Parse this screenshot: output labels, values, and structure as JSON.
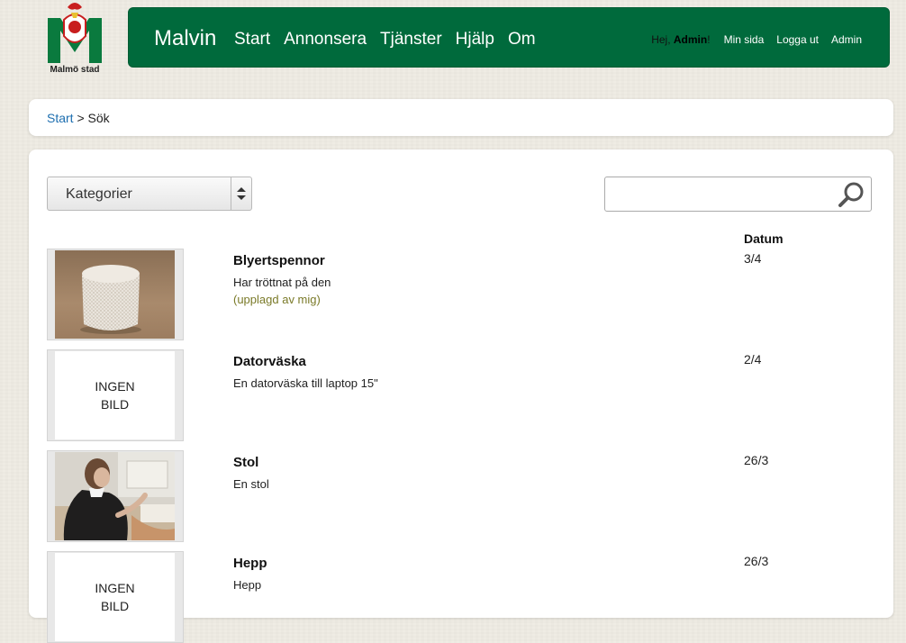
{
  "logo": {
    "text": "Malmö stad"
  },
  "header": {
    "brand": "Malvin",
    "nav": [
      "Start",
      "Annonsera",
      "Tjänster",
      "Hjälp",
      "Om"
    ],
    "greeting_prefix": "Hej, ",
    "user": "Admin",
    "greeting_suffix": "!",
    "links": [
      "Min sida",
      "Logga ut",
      "Admin"
    ]
  },
  "breadcrumb": {
    "home": "Start",
    "separator": " > ",
    "current": "Sök"
  },
  "filters": {
    "category_label": "Kategorier",
    "search_value": ""
  },
  "list": {
    "date_header": "Datum",
    "items": [
      {
        "title": "Blyertspennor",
        "description": "Har tröttnat på den",
        "owner_note": "(upplagd av mig)",
        "date": "3/4",
        "image": "coconut-cake-photo",
        "no_image_text": ""
      },
      {
        "title": "Datorväska",
        "description": "En datorväska till laptop 15\"",
        "owner_note": "",
        "date": "2/4",
        "image": "none",
        "no_image_text": "INGEN\nBILD"
      },
      {
        "title": "Stol",
        "description": "En stol",
        "owner_note": "",
        "date": "26/3",
        "image": "person-on-chair-photo",
        "no_image_text": ""
      },
      {
        "title": "Hepp",
        "description": "Hepp",
        "owner_note": "",
        "date": "26/3",
        "image": "none",
        "no_image_text": "INGEN\nBILD"
      }
    ]
  },
  "colors": {
    "header_green": "#006a3c",
    "link_blue": "#1e6fb0",
    "owner_olive": "#7a7a28"
  },
  "icons": {
    "search": "magnifier-icon",
    "select": "updown-arrows-icon"
  }
}
